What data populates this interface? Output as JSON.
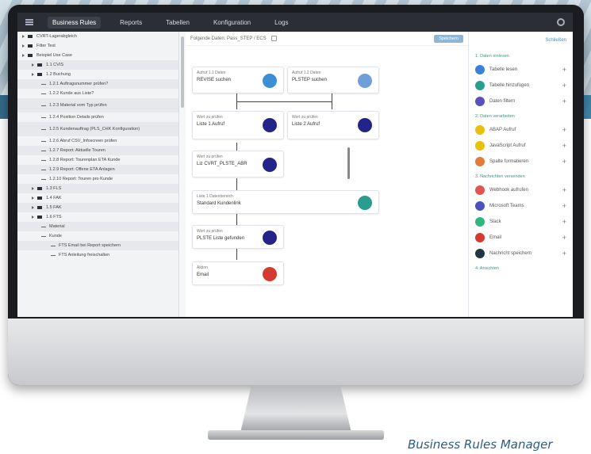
{
  "topbar": {
    "tabs": [
      "Business Rules",
      "Reports",
      "Tabellen",
      "Konfiguration",
      "Logs"
    ],
    "active_tab": "Business Rules"
  },
  "left_tree": [
    {
      "label": "CVRT-Lagerabgleich",
      "shaded": false,
      "indent": 0
    },
    {
      "label": "Filter Test",
      "shaded": false,
      "indent": 0
    },
    {
      "label": "Beispiel Use Case",
      "shaded": false,
      "indent": 0
    },
    {
      "label": "1.1 CVIS",
      "shaded": true,
      "indent": 1
    },
    {
      "label": "1.2 Buchung",
      "shaded": false,
      "indent": 1
    },
    {
      "label": "1.2.1 Auftragsnummer prüfen?",
      "shaded": true,
      "indent": 2
    },
    {
      "label": "1.2.2 Kunde aus Liste?",
      "shaded": false,
      "indent": 2
    },
    {
      "label": "1.2.3 Material vom Typ prüfen",
      "shaded": true,
      "indent": 2,
      "tall": true
    },
    {
      "label": "1.2.4 Position Details prüfen",
      "shaded": false,
      "indent": 2
    },
    {
      "label": "1.2.5 Kundenauftrag (PLS_CHK Konfiguration)",
      "shaded": true,
      "indent": 2,
      "tall": true
    },
    {
      "label": "1.2.6 Abruf CSV_Infoscreen prüfen",
      "shaded": false,
      "indent": 2
    },
    {
      "label": "1.2.7 Report: Aktuelle Touren",
      "shaded": true,
      "indent": 2
    },
    {
      "label": "1.2.8 Report: Tourenplan ETA Kunde",
      "shaded": false,
      "indent": 2
    },
    {
      "label": "1.2.9 Report: Offene ETA Anlagen",
      "shaded": true,
      "indent": 2
    },
    {
      "label": "1.2.10 Report: Touren pro Kunde",
      "shaded": false,
      "indent": 2
    },
    {
      "label": "1.3 FLS",
      "shaded": true,
      "indent": 1
    },
    {
      "label": "1.4 FAK",
      "shaded": false,
      "indent": 1
    },
    {
      "label": "1.5 FAK",
      "shaded": true,
      "indent": 1
    },
    {
      "label": "1.6 FTS",
      "shaded": false,
      "indent": 1
    },
    {
      "label": "Material",
      "shaded": true,
      "indent": 2
    },
    {
      "label": "Kunde",
      "shaded": false,
      "indent": 2
    },
    {
      "label": "FTS Email bei Report speichern",
      "shaded": true,
      "indent": 3
    },
    {
      "label": "FTS Anleitung freischalten",
      "shaded": false,
      "indent": 3
    }
  ],
  "center": {
    "header_title": "Folgende Daten: Pass_STEP / ECS",
    "save_label": "Speichern",
    "cards": [
      {
        "small": "Aufruf 1.1 Daten",
        "title": "REVISE suchen",
        "color": "#3b8fd6"
      },
      {
        "small": "Aufruf 1.2 Daten",
        "title": "PLSTEP suchen",
        "color": "#6f9fd8"
      },
      {
        "small": "Wert zu prüfen",
        "title": "Liste 1 Aufruf",
        "color": "#23238a"
      },
      {
        "small": "Wert zu prüfen",
        "title": "Liste 2 Aufruf",
        "color": "#23238a"
      },
      {
        "small": "Wert zu prüfen",
        "title": "Liz CVRT_PLSTE_ABR",
        "color": "#23238a"
      },
      {
        "small": "Liste 1 Datenbereich",
        "title": "Standard Kundenlink",
        "color": "#2a9d8f"
      },
      {
        "small": "Wert zu prüfen",
        "title": "PLSTE Liste gefunden",
        "color": "#23238a"
      },
      {
        "small": "Aktion",
        "title": "Email",
        "color": "#d43a2f"
      }
    ]
  },
  "right": {
    "header_link": "Schließen",
    "sections": [
      {
        "title": "1. Daten einlesen",
        "items": [
          {
            "label": "Tabelle lesen",
            "color": "#3b7fd6"
          },
          {
            "label": "Tabelle hinzufügen",
            "color": "#2a9d8f"
          },
          {
            "label": "Daten filtern",
            "color": "#5b4fbf"
          }
        ]
      },
      {
        "title": "2. Daten verarbeiten",
        "items": [
          {
            "label": "ABAP Aufruf",
            "color": "#e7c10a"
          },
          {
            "label": "JavaScript Aufruf",
            "color": "#e7c10a"
          },
          {
            "label": "Spalte formatieren",
            "color": "#e07b39"
          }
        ]
      },
      {
        "title": "3. Nachrichten versenden",
        "items": [
          {
            "label": "Webhook aufrufen",
            "color": "#e0564e"
          },
          {
            "label": "Microsoft Teams",
            "color": "#4b53bc"
          },
          {
            "label": "Slack",
            "color": "#2eb67d"
          },
          {
            "label": "Email",
            "color": "#d43a2f"
          },
          {
            "label": "Nachricht speichern",
            "color": "#243447"
          }
        ]
      },
      {
        "title": "4. Ansichten",
        "items": []
      }
    ]
  },
  "caption": "Business Rules Manager"
}
